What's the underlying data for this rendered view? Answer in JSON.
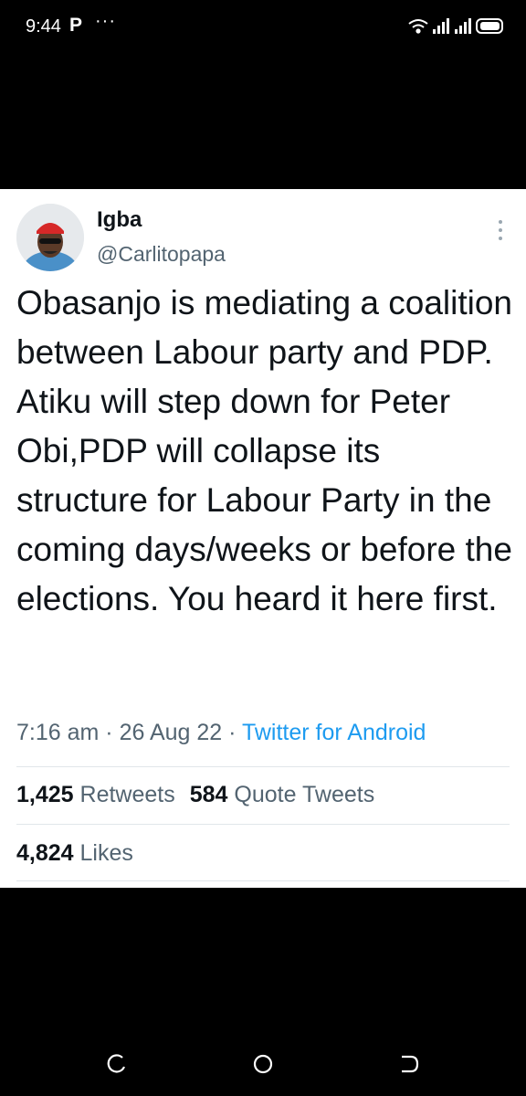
{
  "status_bar": {
    "time": "9:44",
    "app_indicator": "P",
    "more": "···",
    "icons": [
      "wifi-icon",
      "signal-icon",
      "signal-icon",
      "battery-icon"
    ]
  },
  "tweet": {
    "display_name": "Igba",
    "username": "@Carlitopapa",
    "text": "Obasanjo is mediating a coalition between Labour party and PDP. Atiku will step down for Peter Obi,PDP will collapse its structure for Labour Party in the coming days/weeks or before the elections. You heard it here first.",
    "time": "7:16 am",
    "separator": "·",
    "date": "26 Aug 22",
    "source": "Twitter for Android",
    "retweets_count": "1,425",
    "retweets_label": "Retweets",
    "quotes_count": "584",
    "quotes_label": "Quote Tweets",
    "likes_count": "4,824",
    "likes_label": "Likes",
    "colors": {
      "text": "#0f1419",
      "secondary": "#536471",
      "accent": "#1d9bf0"
    }
  },
  "nav_bar": {
    "icons": [
      "recents-icon",
      "home-icon",
      "back-icon"
    ]
  }
}
